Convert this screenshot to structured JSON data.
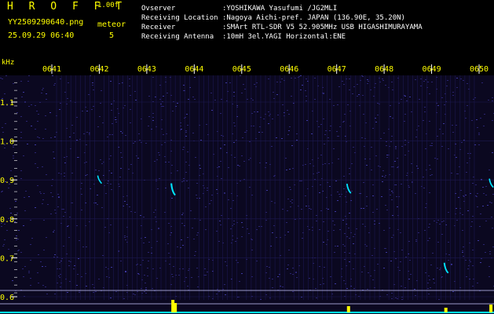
{
  "header": {
    "title": "H R O F F T",
    "version": "1.00f",
    "filename": "YY2509290640.png",
    "meteor_label": "meteor",
    "meteor_count": "5",
    "datetime": "25.09.29 06:40",
    "observer": "Ovserver           :YOSHIKAWA Yasufumi /JG2MLI",
    "location": "Receiving Location :Nagoya Aichi-pref. JAPAN (136.90E, 35.20N)",
    "receiver": "Receiver           :SMArt RTL-SDR V5 52.905MHz USB HIGASHIMURAYAMA",
    "antenna": "Receiving Antenna  :10mH 3el.YAGI Horizontal:ENE"
  },
  "spectrogram": {
    "unit_label": "kHz",
    "time_labels": [
      "0641",
      "0642",
      "0643",
      "0644",
      "0645",
      "0646",
      "0647",
      "0648",
      "0649",
      "0650"
    ],
    "freq_labels": [
      "1.1",
      "1.0",
      "0.9",
      "0.8",
      "0.7",
      "0.6"
    ],
    "freq_values": [
      1.1,
      1.0,
      0.9,
      0.8,
      0.7,
      0.6
    ],
    "time_range_minutes": [
      0,
      10
    ],
    "freq_range_khz": [
      0.58,
      1.2
    ],
    "colors": {
      "axis_text": "#ffff00",
      "tick": "#ffffff",
      "background": "#0b0820",
      "noise": "#2a2470",
      "grid": "#1c1850",
      "echo": "#00e5ff",
      "bottom_bars": "#ffff00",
      "baseline": "#00ffff",
      "hline": "#c8c8ff"
    },
    "echoes": [
      {
        "time_min": 2.55,
        "freq_khz": 0.865,
        "strength": 0.9
      },
      {
        "time_min": 6.25,
        "freq_khz": 0.87,
        "strength": 0.6
      },
      {
        "time_min": 8.3,
        "freq_khz": 0.665,
        "strength": 0.7
      },
      {
        "time_min": 9.25,
        "freq_khz": 0.885,
        "strength": 0.5
      },
      {
        "time_min": 1.0,
        "freq_khz": 0.895,
        "strength": 0.4
      }
    ]
  }
}
